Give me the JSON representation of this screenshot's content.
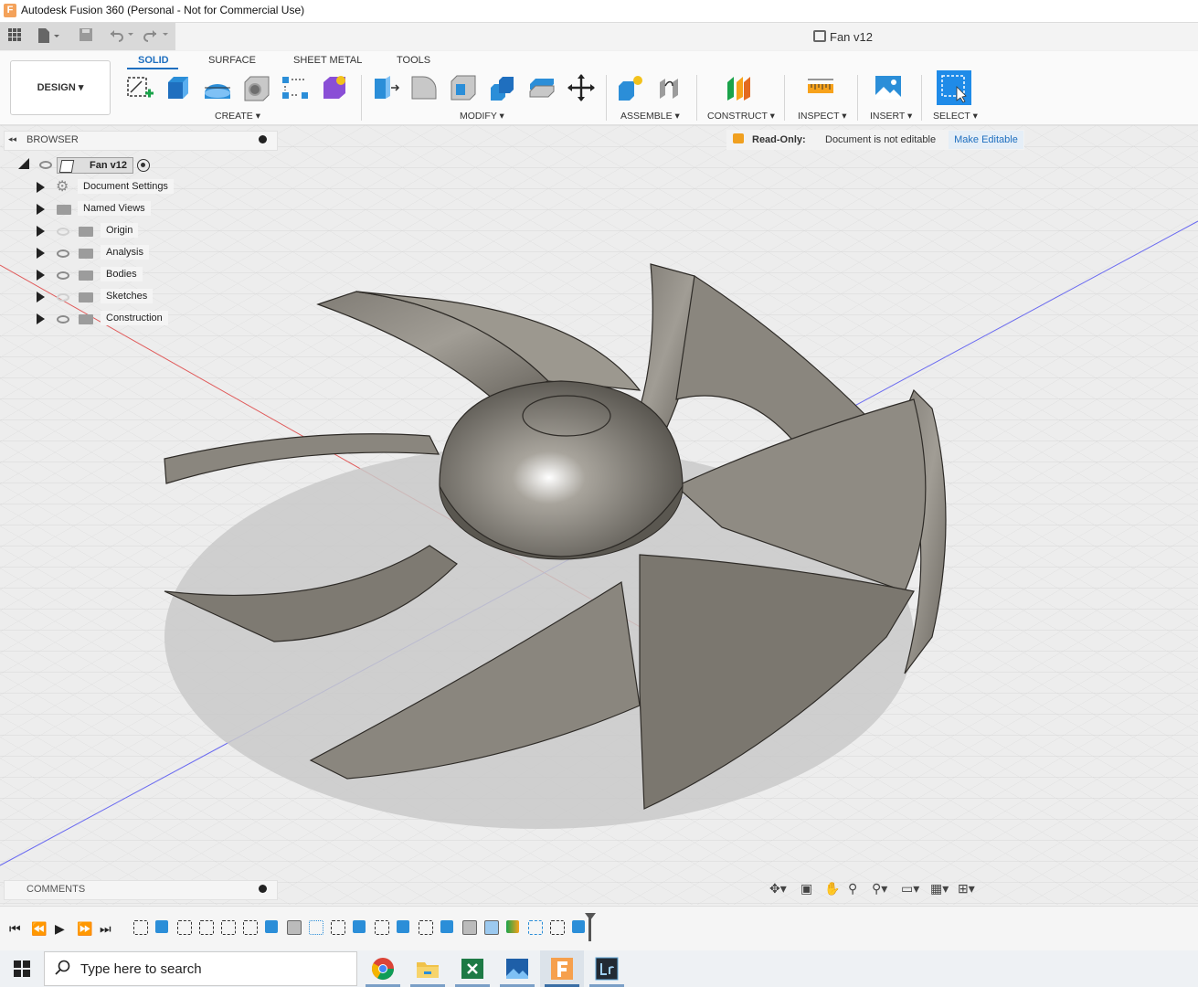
{
  "window": {
    "title": "Autodesk Fusion 360 (Personal - Not for Commercial Use)",
    "app_icon_letter": "F"
  },
  "document": {
    "title": "Fan v12"
  },
  "workspace": {
    "label": "DESIGN ▾"
  },
  "tabs": [
    {
      "label": "SOLID",
      "active": true
    },
    {
      "label": "SURFACE"
    },
    {
      "label": "SHEET METAL"
    },
    {
      "label": "TOOLS"
    }
  ],
  "groups": {
    "create": "CREATE ▾",
    "modify": "MODIFY ▾",
    "assemble": "ASSEMBLE ▾",
    "construct": "CONSTRUCT ▾",
    "inspect": "INSPECT ▾",
    "insert": "INSERT ▾",
    "select": "SELECT ▾"
  },
  "browser": {
    "label": "BROWSER",
    "root": "Fan v12",
    "items": [
      {
        "label": "Document Settings"
      },
      {
        "label": "Named Views"
      },
      {
        "label": "Origin"
      },
      {
        "label": "Analysis"
      },
      {
        "label": "Bodies"
      },
      {
        "label": "Sketches"
      },
      {
        "label": "Construction"
      }
    ]
  },
  "readonly": {
    "label": "Read-Only:",
    "message": "Document is not editable",
    "button": "Make Editable"
  },
  "comments": {
    "label": "COMMENTS"
  },
  "taskbar": {
    "search_placeholder": "Type here to search"
  },
  "colors": {
    "accent": "#1f6fbf",
    "model": "#6e6a63",
    "grid": "#dcdcdc"
  }
}
